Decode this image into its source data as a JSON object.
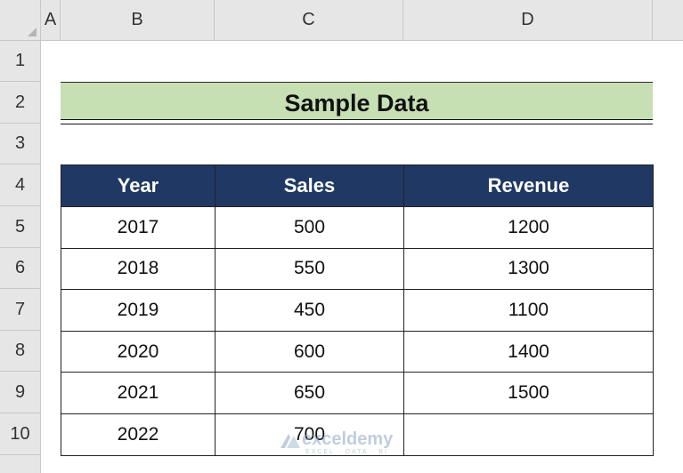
{
  "columns": [
    "A",
    "B",
    "C",
    "D"
  ],
  "rows": [
    "1",
    "2",
    "3",
    "4",
    "5",
    "6",
    "7",
    "8",
    "9",
    "10"
  ],
  "title": "Sample Data",
  "table": {
    "headers": [
      "Year",
      "Sales",
      "Revenue"
    ],
    "rows": [
      [
        "2017",
        "500",
        "1200"
      ],
      [
        "2018",
        "550",
        "1300"
      ],
      [
        "2019",
        "450",
        "1100"
      ],
      [
        "2020",
        "600",
        "1400"
      ],
      [
        "2021",
        "650",
        "1500"
      ],
      [
        "2022",
        "700",
        ""
      ]
    ]
  },
  "watermark": {
    "name": "exceldemy",
    "tagline": "EXCEL · DATA · BI"
  },
  "colors": {
    "header_bg": "#203864",
    "title_bg": "#c6e0b4",
    "grid_header_bg": "#e6e6e6"
  }
}
